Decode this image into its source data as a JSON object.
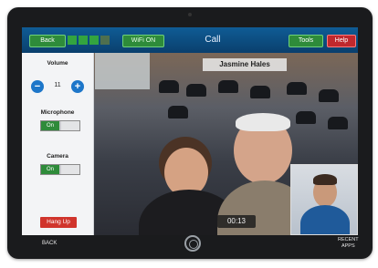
{
  "topbar": {
    "back_label": "Back",
    "wifi_label": "WiFi ON",
    "title": "Call",
    "tools_label": "Tools",
    "help_label": "Help",
    "signal_level": 0.75
  },
  "panel": {
    "volume_label": "Volume",
    "volume_value": "11",
    "minus": "−",
    "plus": "+",
    "microphone_label": "Microphone",
    "microphone_state": "On",
    "camera_label": "Camera",
    "camera_state": "On",
    "hangup_label": "Hang Up"
  },
  "video": {
    "caller_name": "Jasmine Hales",
    "timer": "00:13"
  },
  "device_nav": {
    "back_label": "BACK",
    "recent_label_1": "RECENT",
    "recent_label_2": "APPS"
  }
}
